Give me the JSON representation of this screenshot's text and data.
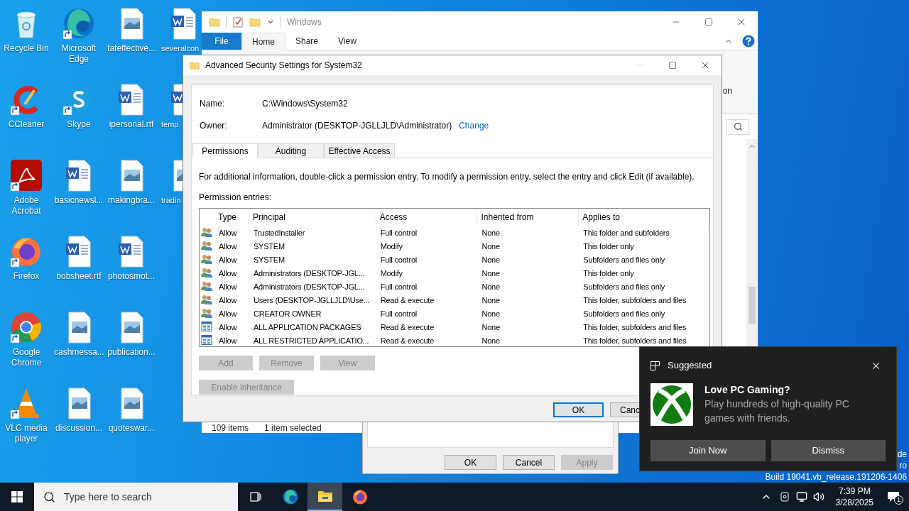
{
  "desktop": {
    "columns": [
      [
        {
          "label": "Recycle Bin",
          "kind": "recycle",
          "shortcut": false
        },
        {
          "label": "CCleaner",
          "kind": "ccleaner",
          "shortcut": true
        },
        {
          "label": "Adobe Acrobat",
          "kind": "acrobat",
          "shortcut": true
        },
        {
          "label": "Firefox",
          "kind": "firefox",
          "shortcut": true
        },
        {
          "label": "Google Chrome",
          "kind": "chrome",
          "shortcut": true
        },
        {
          "label": "VLC media player",
          "kind": "vlc",
          "shortcut": true
        }
      ],
      [
        {
          "label": "Microsoft Edge",
          "kind": "edge",
          "shortcut": true
        },
        {
          "label": "Skype",
          "kind": "skype",
          "shortcut": true
        },
        {
          "label": "basicnewsl...",
          "kind": "word",
          "shortcut": false
        },
        {
          "label": "bobsheet.rtf",
          "kind": "word",
          "shortcut": false
        },
        {
          "label": "cashmessa...",
          "kind": "image",
          "shortcut": false
        },
        {
          "label": "discussion...",
          "kind": "image",
          "shortcut": false
        }
      ],
      [
        {
          "label": "fateffective...",
          "kind": "image",
          "shortcut": false
        },
        {
          "label": "ipersonal.rtf",
          "kind": "word",
          "shortcut": false
        },
        {
          "label": "makingbra...",
          "kind": "image",
          "shortcut": false
        },
        {
          "label": "photosmot...",
          "kind": "word",
          "shortcut": false
        },
        {
          "label": "publication...",
          "kind": "image",
          "shortcut": false
        },
        {
          "label": "quoteswar...",
          "kind": "image",
          "shortcut": false
        }
      ],
      [
        {
          "label": "severalcon",
          "kind": "word",
          "shortcut": false
        },
        {
          "label": "temp",
          "kind": "word",
          "shortcut": false
        },
        {
          "label": "tradin",
          "kind": "image",
          "shortcut": false
        }
      ]
    ],
    "corner_text": [
      "de",
      "ro",
      "Build 19041.vb_release.191206-1406"
    ]
  },
  "explorer": {
    "title": "Windows",
    "ribbon_tabs": [
      {
        "label": "File",
        "kind": "file",
        "selected": false
      },
      {
        "label": "Home",
        "kind": "tab",
        "selected": true
      },
      {
        "label": "Share",
        "kind": "tab",
        "selected": false
      },
      {
        "label": "View",
        "kind": "tab",
        "selected": false
      }
    ],
    "ribbon_fragment": "on",
    "status": [
      "109 items",
      "1 item selected"
    ]
  },
  "properties_dialog": {
    "buttons": [
      {
        "label": "OK",
        "disabled": false
      },
      {
        "label": "Cancel",
        "disabled": false
      },
      {
        "label": "Apply",
        "disabled": true
      }
    ]
  },
  "advanced_security": {
    "title": "Advanced Security Settings for System32",
    "fields": [
      {
        "label": "Name:",
        "value": "C:\\Windows\\System32"
      },
      {
        "label": "Owner:",
        "value": "Administrator (DESKTOP-JGLLJLD\\Administrator)",
        "link": "Change"
      }
    ],
    "tabs": [
      {
        "label": "Permissions",
        "selected": true
      },
      {
        "label": "Auditing",
        "selected": false
      },
      {
        "label": "Effective Access",
        "selected": false
      }
    ],
    "info": "For additional information, double-click a permission entry. To modify a permission entry, select the entry and click Edit (if available).",
    "entries_label": "Permission entries:",
    "columns": [
      "Type",
      "Principal",
      "Access",
      "Inherited from",
      "Applies to"
    ],
    "rows": [
      {
        "kind": "user",
        "cells": [
          "Allow",
          "TrustedInstaller",
          "Full control",
          "None",
          "This folder and subfolders"
        ]
      },
      {
        "kind": "user",
        "cells": [
          "Allow",
          "SYSTEM",
          "Modify",
          "None",
          "This folder only"
        ]
      },
      {
        "kind": "user",
        "cells": [
          "Allow",
          "SYSTEM",
          "Full control",
          "None",
          "Subfolders and files only"
        ]
      },
      {
        "kind": "user",
        "cells": [
          "Allow",
          "Administrators (DESKTOP-JGL...",
          "Modify",
          "None",
          "This folder only"
        ]
      },
      {
        "kind": "user",
        "cells": [
          "Allow",
          "Administrators (DESKTOP-JGL...",
          "Full control",
          "None",
          "Subfolders and files only"
        ]
      },
      {
        "kind": "user",
        "cells": [
          "Allow",
          "Users (DESKTOP-JGLLJLD\\Use...",
          "Read & execute",
          "None",
          "This folder, subfolders and files"
        ]
      },
      {
        "kind": "user",
        "cells": [
          "Allow",
          "CREATOR OWNER",
          "Full control",
          "None",
          "Subfolders and files only"
        ]
      },
      {
        "kind": "package",
        "cells": [
          "Allow",
          "ALL APPLICATION PACKAGES",
          "Read & execute",
          "None",
          "This folder, subfolders and files"
        ]
      },
      {
        "kind": "package",
        "cells": [
          "Allow",
          "ALL RESTRICTED APPLICATIO...",
          "Read & execute",
          "None",
          "This folder, subfolders and files"
        ]
      }
    ],
    "action_buttons": [
      {
        "label": "Add",
        "disabled": true
      },
      {
        "label": "Remove",
        "disabled": true
      },
      {
        "label": "View",
        "disabled": true
      }
    ],
    "inheritance_button": {
      "label": "Enable inheritance",
      "disabled": true
    },
    "footer_buttons": [
      {
        "label": "OK",
        "default": true
      },
      {
        "label": "Canc"
      }
    ]
  },
  "toast": {
    "header": "Suggested",
    "title": "Love PC Gaming?",
    "body": "Play hundreds of high-quality PC games with friends.",
    "buttons": [
      "Join Now",
      "Dismiss"
    ]
  },
  "taskbar": {
    "search_placeholder": "Type here to search",
    "apps": [
      {
        "kind": "taskview",
        "active": false
      },
      {
        "kind": "edge",
        "active": false
      },
      {
        "kind": "explorer",
        "active": true
      },
      {
        "kind": "firefox",
        "active": false
      }
    ],
    "time": "7:39 PM",
    "date": "3/28/2025",
    "notification_count": "1"
  }
}
